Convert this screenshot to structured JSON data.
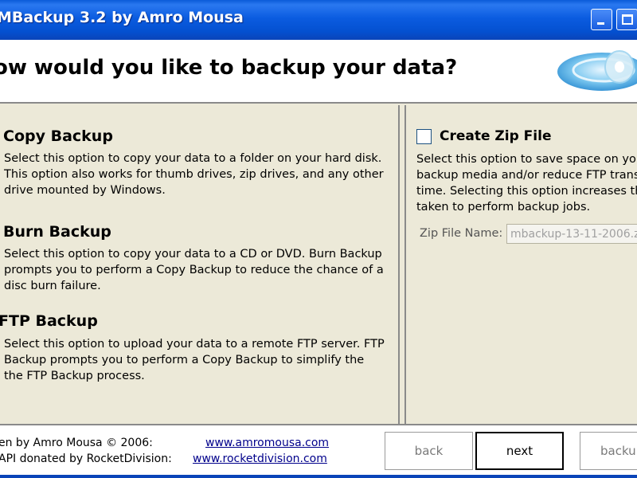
{
  "window": {
    "title": "MBackup 3.2 by Amro Mousa"
  },
  "header": {
    "question": "ow would you like to backup your data?"
  },
  "options": [
    {
      "title": "Copy Backup",
      "description": "Select this option to copy your data to a folder on your hard disk. This option also works for thumb drives, zip drives, and any other drive mounted by Windows."
    },
    {
      "title": "Burn Backup",
      "description": "Select this option to copy your data to a CD or DVD.  Burn Backup prompts you to perform a Copy Backup to reduce the chance of a disc burn failure."
    },
    {
      "title": "FTP Backup",
      "description": "Select this option to upload your data to a remote FTP server. FTP Backup prompts you to perform a Copy Backup to simplify the the FTP Backup process."
    }
  ],
  "zip": {
    "checkbox_label": "Create Zip File",
    "checked": false,
    "description_lines": [
      "Select this option to save space on you",
      "backup media and/or reduce FTP trans",
      "time. Selecting this option increases the",
      "taken to perform backup jobs."
    ],
    "filename_label": "Zip File Name:",
    "filename_value": "mbackup-13-11-2006.z"
  },
  "footer": {
    "credit_line1": "en by Amro Mousa © 2006:",
    "credit_line2": "API donated by RocketDivision:",
    "link1": "www.amromousa.com",
    "link2": "www.rocketdivision.com"
  },
  "buttons": {
    "back": "back",
    "next": "next",
    "backup": "backup"
  }
}
